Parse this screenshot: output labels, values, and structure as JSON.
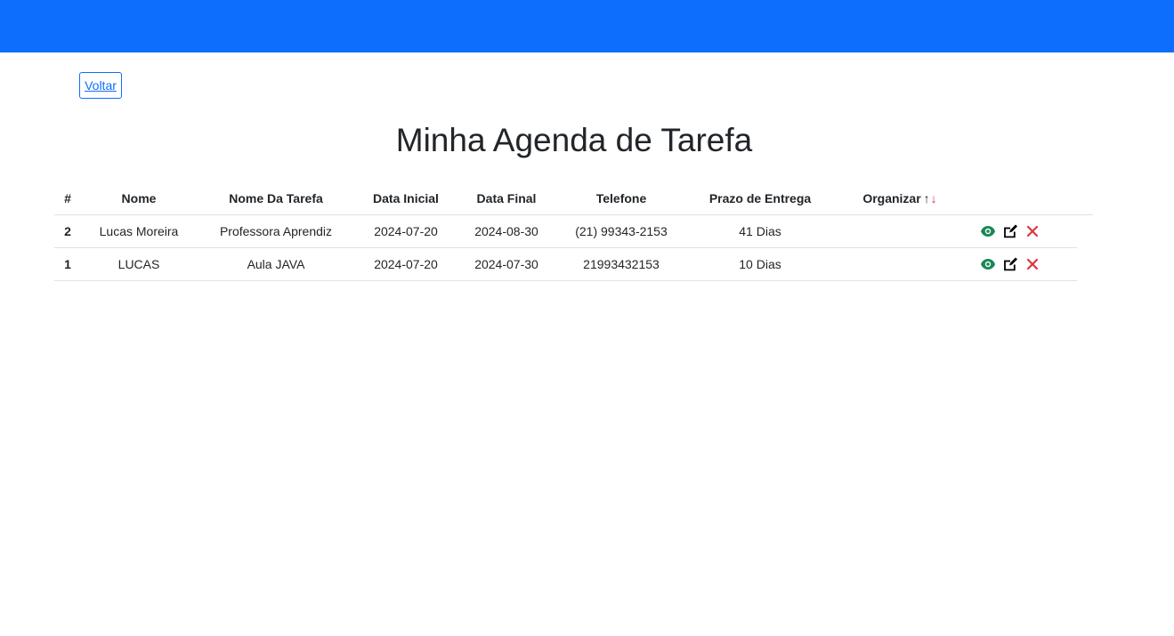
{
  "nav": {
    "back_label": "Voltar"
  },
  "page": {
    "title": "Minha Agenda de Tarefa"
  },
  "table": {
    "headers": {
      "id": "#",
      "nome": "Nome",
      "tarefa": "Nome Da Tarefa",
      "data_inicial": "Data Inicial",
      "data_final": "Data Final",
      "telefone": "Telefone",
      "prazo": "Prazo de Entrega",
      "organizar": "Organizar",
      "sort_up": "↑",
      "sort_down": "↓"
    },
    "rows": [
      {
        "id": "2",
        "nome": "Lucas Moreira",
        "tarefa": "Professora Aprendiz",
        "data_inicial": "2024-07-20",
        "data_final": "2024-08-30",
        "telefone": "(21) 99343-2153",
        "prazo": "41 Dias"
      },
      {
        "id": "1",
        "nome": "LUCAS",
        "tarefa": "Aula JAVA",
        "data_inicial": "2024-07-20",
        "data_final": "2024-07-30",
        "telefone": "21993432153",
        "prazo": "10 Dias"
      }
    ],
    "actions": {
      "view_icon": "eye-icon",
      "edit_icon": "edit-icon",
      "delete_icon": "close-icon"
    }
  },
  "colors": {
    "header_bar": "#0d6efd",
    "view": "#198754",
    "edit": "#000000",
    "delete": "#dc3545",
    "sort_down": "#dc3545"
  }
}
